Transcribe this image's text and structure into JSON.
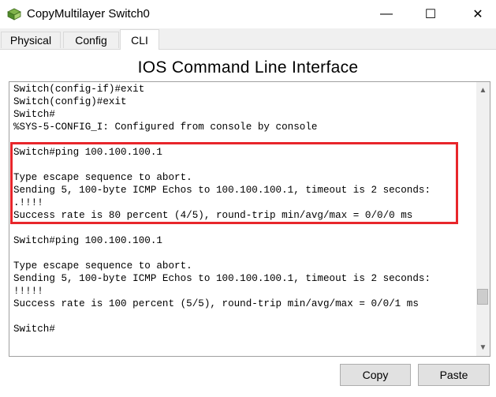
{
  "window": {
    "title": "CopyMultilayer Switch0",
    "minimize_glyph": "—",
    "maximize_glyph": "☐",
    "close_glyph": "✕"
  },
  "tabs": [
    {
      "label": "Physical"
    },
    {
      "label": "Config"
    },
    {
      "label": "CLI",
      "active": true
    }
  ],
  "heading": "IOS Command Line Interface",
  "terminal": {
    "lines": [
      "Switch(config-if)#exit",
      "Switch(config)#exit",
      "Switch#",
      "%SYS-5-CONFIG_I: Configured from console by console",
      "",
      "Switch#ping 100.100.100.1",
      "",
      "Type escape sequence to abort.",
      "Sending 5, 100-byte ICMP Echos to 100.100.100.1, timeout is 2 seconds:",
      ".!!!!",
      "Success rate is 80 percent (4/5), round-trip min/avg/max = 0/0/0 ms",
      "",
      "Switch#ping 100.100.100.1",
      "",
      "Type escape sequence to abort.",
      "Sending 5, 100-byte ICMP Echos to 100.100.100.1, timeout is 2 seconds:",
      "!!!!!",
      "Success rate is 100 percent (5/5), round-trip min/avg/max = 0/0/1 ms",
      "",
      "Switch#"
    ],
    "highlight_color": "#e8262b"
  },
  "scrollbar": {
    "up_glyph": "▲",
    "down_glyph": "▼"
  },
  "buttons": {
    "copy_label": "Copy",
    "paste_label": "Paste"
  }
}
